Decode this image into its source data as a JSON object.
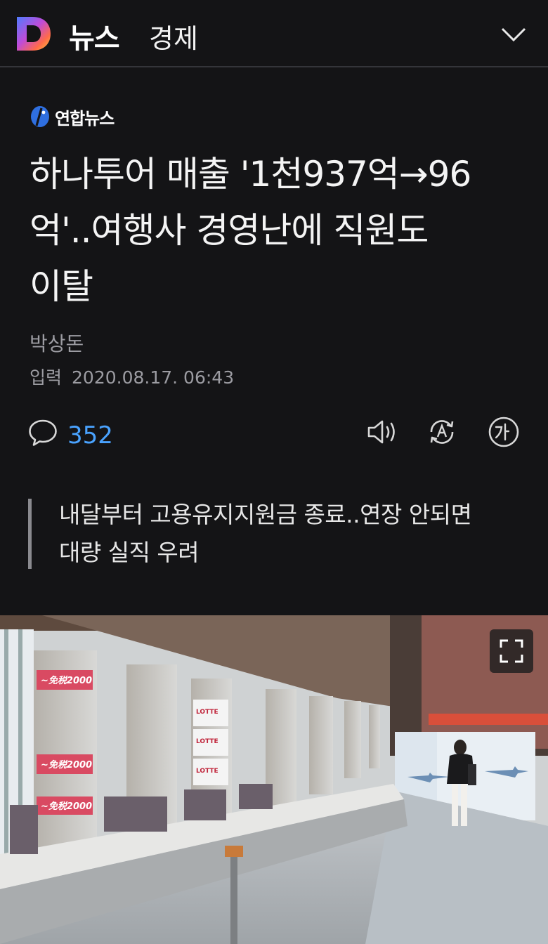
{
  "header": {
    "news_label": "뉴스",
    "section": "경제",
    "logo_icon": "daum-d-logo",
    "menu_icon": "chevron-down-icon"
  },
  "article": {
    "source": "연합뉴스",
    "headline_lines": [
      "하나투어 매출 '1천937억→96",
      "억'..여행사 경영난에 직원도",
      "이탈"
    ],
    "author": "박상돈",
    "date_label": "입력",
    "date_value": "2020.08.17. 06:43",
    "comment_count": "352",
    "summary_lines": [
      "내달부터 고용유지지원금 종료..연장 안되면",
      "대량 실직 우려"
    ]
  },
  "photo_signs": {
    "duty_free": "~免税2000",
    "brand": "LOTTE"
  },
  "colors": {
    "background": "#141416",
    "accent_blue": "#4aa3ff",
    "muted_text": "#9c9ca2"
  }
}
